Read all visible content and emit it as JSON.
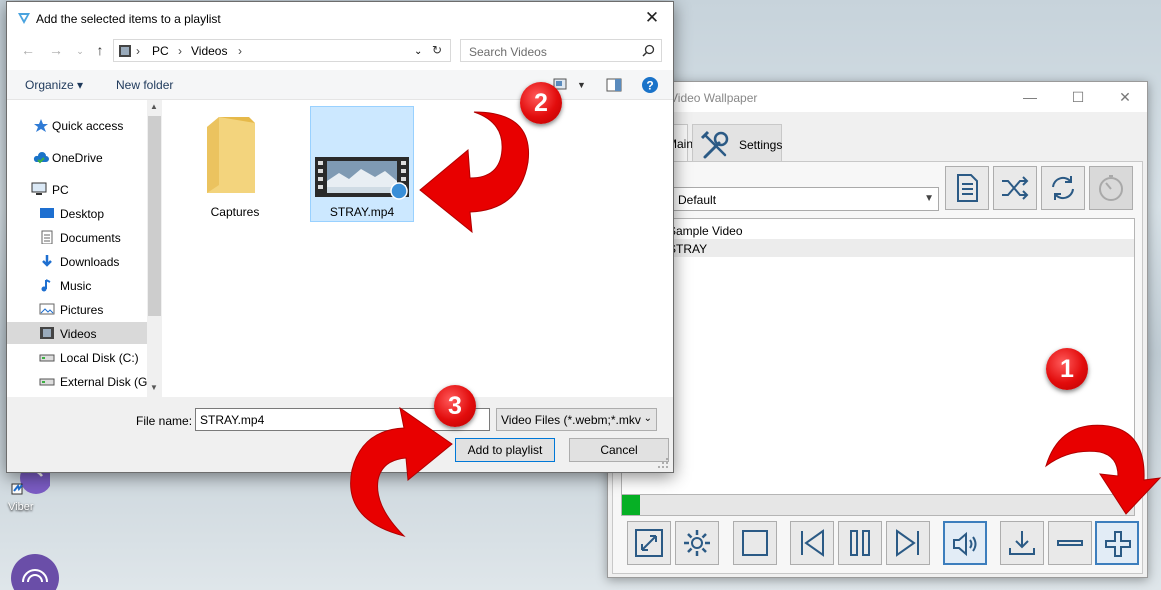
{
  "desktop": {
    "viber_label": "Viber"
  },
  "video_wallpaper": {
    "title": "Video Wallpaper",
    "tabs": [
      {
        "label": "Main"
      },
      {
        "label": "Settings"
      }
    ],
    "playlist_combo_value": "Default",
    "playlist_items": [
      "Sample Video",
      "STRAY"
    ],
    "progress_fraction": 0.035,
    "accent_color": "#3d7ebd",
    "progress_color": "#06b025"
  },
  "dialog": {
    "title": "Add the selected items to a playlist",
    "address": {
      "crumbs": [
        "PC",
        "Videos"
      ]
    },
    "search_placeholder": "Search Videos",
    "commands": {
      "organize": "Organize",
      "new_folder": "New folder"
    },
    "nav_items": [
      {
        "label": "Quick access",
        "icon": "star-icon"
      },
      {
        "label": "OneDrive",
        "icon": "cloud-icon"
      },
      {
        "label": "PC",
        "icon": "computer-icon"
      },
      {
        "label": "Desktop",
        "icon": "desktop-icon"
      },
      {
        "label": "Documents",
        "icon": "document-icon"
      },
      {
        "label": "Downloads",
        "icon": "download-icon"
      },
      {
        "label": "Music",
        "icon": "music-icon"
      },
      {
        "label": "Pictures",
        "icon": "picture-icon"
      },
      {
        "label": "Videos",
        "icon": "video-icon"
      },
      {
        "label": "Local Disk (C:)",
        "icon": "drive-icon"
      },
      {
        "label": "External Disk (G:)",
        "icon": "drive-icon"
      }
    ],
    "files": [
      {
        "name": "Captures",
        "type": "folder"
      },
      {
        "name": "STRAY.mp4",
        "type": "video"
      }
    ],
    "file_name_label": "File name:",
    "file_name_value": "STRAY.mp4",
    "file_type_value": "Video Files (*.webm;*.mkv;*.flv;",
    "add_button": "Add to playlist",
    "cancel_button": "Cancel"
  },
  "annotations": {
    "badges": [
      "1",
      "2",
      "3"
    ],
    "color": "#e20c0c"
  }
}
